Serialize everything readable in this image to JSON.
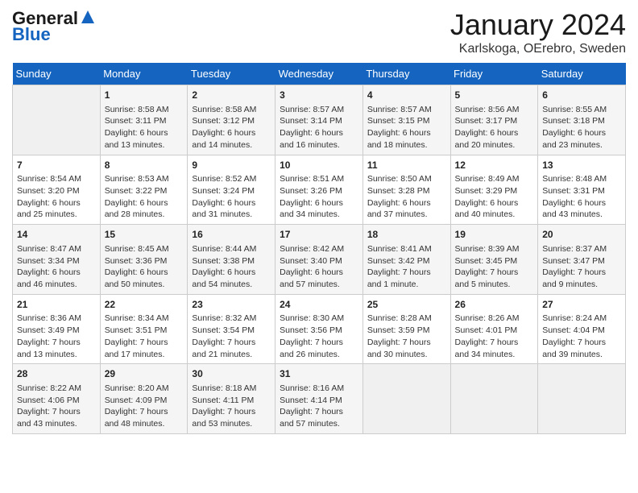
{
  "header": {
    "logo_general": "General",
    "logo_blue": "Blue",
    "month_year": "January 2024",
    "location": "Karlskoga, OErebro, Sweden"
  },
  "weekdays": [
    "Sunday",
    "Monday",
    "Tuesday",
    "Wednesday",
    "Thursday",
    "Friday",
    "Saturday"
  ],
  "weeks": [
    [
      {
        "day": "",
        "info": ""
      },
      {
        "day": "1",
        "info": "Sunrise: 8:58 AM\nSunset: 3:11 PM\nDaylight: 6 hours\nand 13 minutes."
      },
      {
        "day": "2",
        "info": "Sunrise: 8:58 AM\nSunset: 3:12 PM\nDaylight: 6 hours\nand 14 minutes."
      },
      {
        "day": "3",
        "info": "Sunrise: 8:57 AM\nSunset: 3:14 PM\nDaylight: 6 hours\nand 16 minutes."
      },
      {
        "day": "4",
        "info": "Sunrise: 8:57 AM\nSunset: 3:15 PM\nDaylight: 6 hours\nand 18 minutes."
      },
      {
        "day": "5",
        "info": "Sunrise: 8:56 AM\nSunset: 3:17 PM\nDaylight: 6 hours\nand 20 minutes."
      },
      {
        "day": "6",
        "info": "Sunrise: 8:55 AM\nSunset: 3:18 PM\nDaylight: 6 hours\nand 23 minutes."
      }
    ],
    [
      {
        "day": "7",
        "info": "Sunrise: 8:54 AM\nSunset: 3:20 PM\nDaylight: 6 hours\nand 25 minutes."
      },
      {
        "day": "8",
        "info": "Sunrise: 8:53 AM\nSunset: 3:22 PM\nDaylight: 6 hours\nand 28 minutes."
      },
      {
        "day": "9",
        "info": "Sunrise: 8:52 AM\nSunset: 3:24 PM\nDaylight: 6 hours\nand 31 minutes."
      },
      {
        "day": "10",
        "info": "Sunrise: 8:51 AM\nSunset: 3:26 PM\nDaylight: 6 hours\nand 34 minutes."
      },
      {
        "day": "11",
        "info": "Sunrise: 8:50 AM\nSunset: 3:28 PM\nDaylight: 6 hours\nand 37 minutes."
      },
      {
        "day": "12",
        "info": "Sunrise: 8:49 AM\nSunset: 3:29 PM\nDaylight: 6 hours\nand 40 minutes."
      },
      {
        "day": "13",
        "info": "Sunrise: 8:48 AM\nSunset: 3:31 PM\nDaylight: 6 hours\nand 43 minutes."
      }
    ],
    [
      {
        "day": "14",
        "info": "Sunrise: 8:47 AM\nSunset: 3:34 PM\nDaylight: 6 hours\nand 46 minutes."
      },
      {
        "day": "15",
        "info": "Sunrise: 8:45 AM\nSunset: 3:36 PM\nDaylight: 6 hours\nand 50 minutes."
      },
      {
        "day": "16",
        "info": "Sunrise: 8:44 AM\nSunset: 3:38 PM\nDaylight: 6 hours\nand 54 minutes."
      },
      {
        "day": "17",
        "info": "Sunrise: 8:42 AM\nSunset: 3:40 PM\nDaylight: 6 hours\nand 57 minutes."
      },
      {
        "day": "18",
        "info": "Sunrise: 8:41 AM\nSunset: 3:42 PM\nDaylight: 7 hours\nand 1 minute."
      },
      {
        "day": "19",
        "info": "Sunrise: 8:39 AM\nSunset: 3:45 PM\nDaylight: 7 hours\nand 5 minutes."
      },
      {
        "day": "20",
        "info": "Sunrise: 8:37 AM\nSunset: 3:47 PM\nDaylight: 7 hours\nand 9 minutes."
      }
    ],
    [
      {
        "day": "21",
        "info": "Sunrise: 8:36 AM\nSunset: 3:49 PM\nDaylight: 7 hours\nand 13 minutes."
      },
      {
        "day": "22",
        "info": "Sunrise: 8:34 AM\nSunset: 3:51 PM\nDaylight: 7 hours\nand 17 minutes."
      },
      {
        "day": "23",
        "info": "Sunrise: 8:32 AM\nSunset: 3:54 PM\nDaylight: 7 hours\nand 21 minutes."
      },
      {
        "day": "24",
        "info": "Sunrise: 8:30 AM\nSunset: 3:56 PM\nDaylight: 7 hours\nand 26 minutes."
      },
      {
        "day": "25",
        "info": "Sunrise: 8:28 AM\nSunset: 3:59 PM\nDaylight: 7 hours\nand 30 minutes."
      },
      {
        "day": "26",
        "info": "Sunrise: 8:26 AM\nSunset: 4:01 PM\nDaylight: 7 hours\nand 34 minutes."
      },
      {
        "day": "27",
        "info": "Sunrise: 8:24 AM\nSunset: 4:04 PM\nDaylight: 7 hours\nand 39 minutes."
      }
    ],
    [
      {
        "day": "28",
        "info": "Sunrise: 8:22 AM\nSunset: 4:06 PM\nDaylight: 7 hours\nand 43 minutes."
      },
      {
        "day": "29",
        "info": "Sunrise: 8:20 AM\nSunset: 4:09 PM\nDaylight: 7 hours\nand 48 minutes."
      },
      {
        "day": "30",
        "info": "Sunrise: 8:18 AM\nSunset: 4:11 PM\nDaylight: 7 hours\nand 53 minutes."
      },
      {
        "day": "31",
        "info": "Sunrise: 8:16 AM\nSunset: 4:14 PM\nDaylight: 7 hours\nand 57 minutes."
      },
      {
        "day": "",
        "info": ""
      },
      {
        "day": "",
        "info": ""
      },
      {
        "day": "",
        "info": ""
      }
    ]
  ]
}
